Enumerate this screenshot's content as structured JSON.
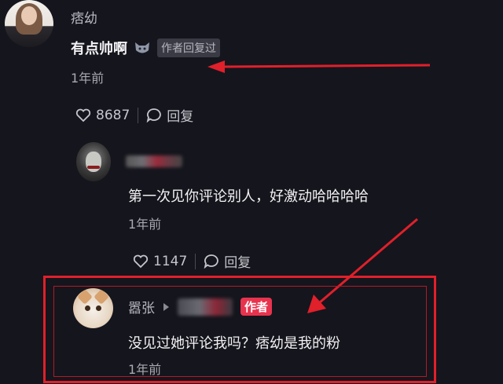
{
  "comments": [
    {
      "username": "痞幼",
      "text": "有点帅啊",
      "emoji": "cat-emoji",
      "author_tag": "作者回复过",
      "time": "1年前",
      "likes": "8687",
      "reply_label": "回复"
    },
    {
      "text": "第一次见你评论别人，好激动哈哈哈哈",
      "time": "1年前",
      "likes": "1147",
      "reply_label": "回复"
    },
    {
      "username": "嚣张",
      "author_tag": "作者",
      "text": "没见过她评论我吗？痞幼是我的粉",
      "time": "1年前"
    }
  ],
  "icons": [
    "heart-icon",
    "comment-bubble-icon",
    "play-triangle-icon"
  ],
  "colors": {
    "background": "#15151d",
    "annotation_red": "#e0202a",
    "author_tag_red": "#e8334e"
  }
}
